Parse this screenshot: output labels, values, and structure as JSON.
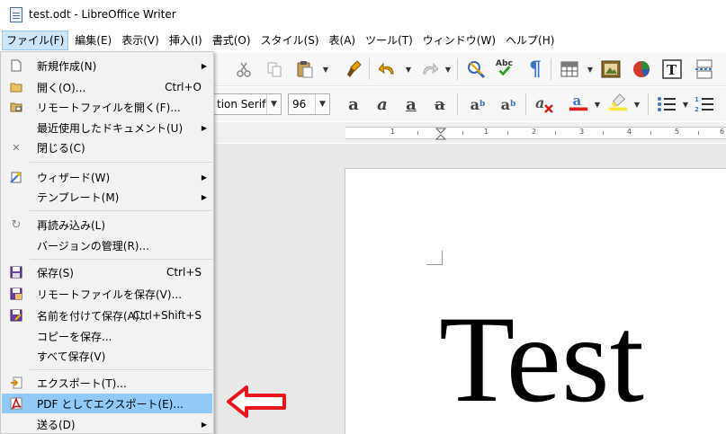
{
  "window": {
    "title": "test.odt - LibreOffice Writer"
  },
  "menubar": [
    {
      "label": "ファイル(F)",
      "active": true
    },
    {
      "label": "編集(E)"
    },
    {
      "label": "表示(V)"
    },
    {
      "label": "挿入(I)"
    },
    {
      "label": "書式(O)"
    },
    {
      "label": "スタイル(S)"
    },
    {
      "label": "表(A)"
    },
    {
      "label": "ツール(T)"
    },
    {
      "label": "ウィンドウ(W)"
    },
    {
      "label": "ヘルプ(H)"
    }
  ],
  "toolbar": {
    "font_name": "tion Serif",
    "font_size": "96"
  },
  "file_menu": {
    "items": [
      {
        "label": "新規作成(N)",
        "icon": "new-document-icon",
        "submenu": true
      },
      {
        "label": "開く(O)...",
        "shortcut": "Ctrl+O",
        "icon": "open-folder-icon"
      },
      {
        "label": "リモートファイルを開く(F)...",
        "icon": "remote-folder-icon"
      },
      {
        "label": "最近使用したドキュメント(U)",
        "submenu": true
      },
      {
        "label": "閉じる(C)",
        "icon": "close-icon"
      },
      {
        "label": "ウィザード(W)",
        "icon": "wizard-icon",
        "submenu": true
      },
      {
        "label": "テンプレート(M)",
        "submenu": true
      },
      {
        "label": "再読み込み(L)",
        "icon": "reload-icon"
      },
      {
        "label": "バージョンの管理(R)..."
      },
      {
        "label": "保存(S)",
        "shortcut": "Ctrl+S",
        "icon": "save-icon"
      },
      {
        "label": "リモートファイルを保存(V)...",
        "icon": "save-remote-icon"
      },
      {
        "label": "名前を付けて保存(A)...",
        "shortcut": "Ctrl+Shift+S",
        "icon": "save-as-icon"
      },
      {
        "label": "コピーを保存..."
      },
      {
        "label": "すべて保存(V)"
      },
      {
        "label": "エクスポート(T)...",
        "icon": "export-icon"
      },
      {
        "label": "PDF としてエクスポート(E)...",
        "icon": "pdf-icon",
        "highlighted": true
      },
      {
        "label": "送る(D)",
        "submenu": true
      }
    ]
  },
  "ruler": {
    "numbers": [
      "1",
      "1",
      "2",
      "3",
      "4",
      "5",
      "6"
    ]
  },
  "document": {
    "text": "Test"
  },
  "colors": {
    "menu_highlight": "#91c9f7",
    "menubar_active": "#cce4f7",
    "annotation_arrow": "#e8141e"
  }
}
